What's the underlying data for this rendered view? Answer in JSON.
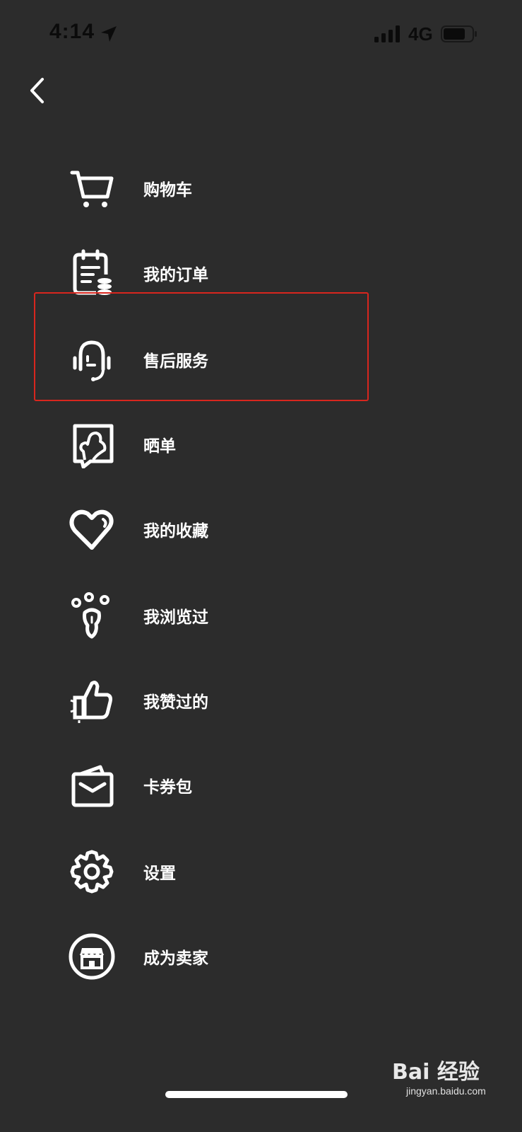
{
  "status_bar": {
    "time": "4:14",
    "network": "4G",
    "icons": [
      "location-arrow-icon",
      "signal-bars-icon",
      "battery-icon"
    ]
  },
  "navigation": {
    "back_icon": "chevron-left-icon"
  },
  "menu": {
    "items": [
      {
        "label": "购物车",
        "icon": "shopping-cart-icon"
      },
      {
        "label": "我的订单",
        "icon": "order-list-icon"
      },
      {
        "label": "售后服务",
        "icon": "customer-service-headset-icon"
      },
      {
        "label": "晒单",
        "icon": "photo-share-icon"
      },
      {
        "label": "我的收藏",
        "icon": "heart-icon"
      },
      {
        "label": "我浏览过",
        "icon": "footprint-icon"
      },
      {
        "label": "我赞过的",
        "icon": "thumbs-up-icon"
      },
      {
        "label": "卡券包",
        "icon": "coupon-wallet-icon"
      },
      {
        "label": "设置",
        "icon": "gear-icon"
      },
      {
        "label": "成为卖家",
        "icon": "storefront-icon"
      }
    ],
    "highlighted_item": "售后服务",
    "highlight_color": "#d8261e"
  },
  "watermark": {
    "brand": "Bai 经验",
    "url": "jingyan.baidu.com"
  },
  "colors": {
    "background": "#2c2c2c",
    "text": "#ffffff",
    "status_text": "#0b0b0b"
  }
}
